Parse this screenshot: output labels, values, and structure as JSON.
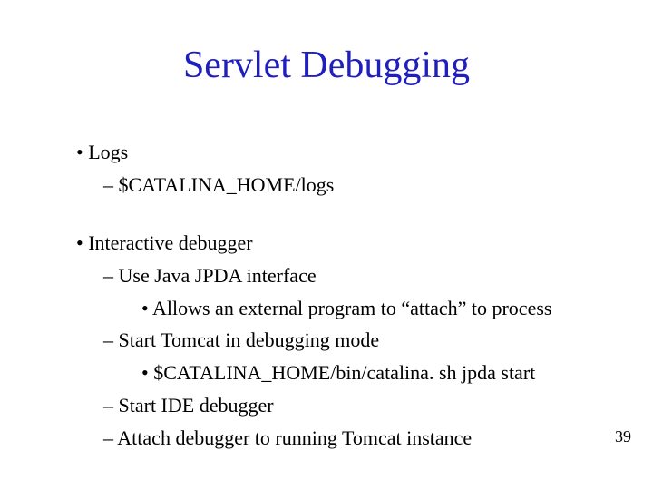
{
  "title": "Servlet Debugging",
  "bullets": {
    "logs": "Logs",
    "logs_path": "$CATALINA_HOME/logs",
    "interactive": "Interactive debugger",
    "jpda": "Use Java JPDA interface",
    "attach": "Allows an external program to “attach” to process",
    "start_tomcat": "Start Tomcat in debugging mode",
    "catalina_cmd": "$CATALINA_HOME/bin/catalina. sh jpda start",
    "start_ide": "Start IDE debugger",
    "attach_debugger": "Attach debugger to running Tomcat instance"
  },
  "page_number": "39"
}
